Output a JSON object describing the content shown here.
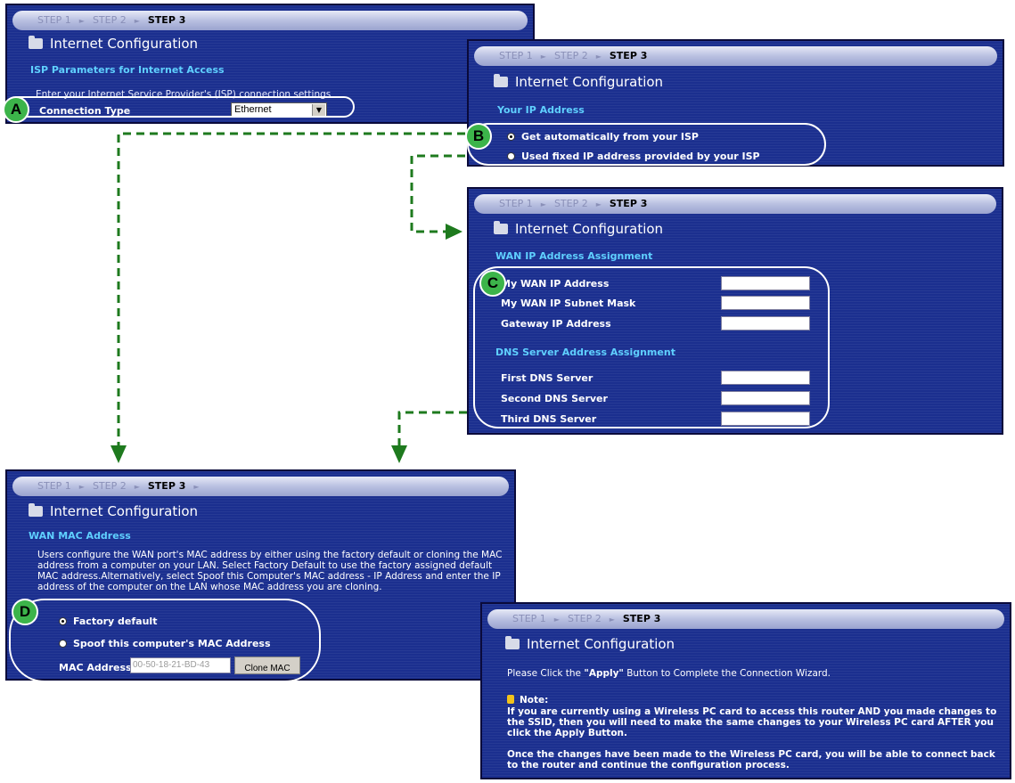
{
  "steps": {
    "step1": "STEP 1",
    "step2": "STEP 2",
    "step3": "STEP 3"
  },
  "panel_title": "Internet Configuration",
  "panel_a": {
    "badge": "A",
    "section": "ISP Parameters for Internet Access",
    "intro": "Enter your Internet Service Provider's (ISP) connection settings",
    "connection_type_label": "Connection Type",
    "connection_type_value": "Ethernet"
  },
  "panel_b": {
    "badge": "B",
    "section": "Your IP Address",
    "option_auto": "Get automatically from your ISP",
    "option_fixed": "Used fixed IP address provided by your ISP",
    "selected": "auto"
  },
  "panel_c": {
    "badge": "C",
    "section_wan": "WAN IP Address Assignment",
    "wan_ip_label": "My WAN IP Address",
    "subnet_label": "My WAN IP Subnet Mask",
    "gateway_label": "Gateway IP Address",
    "section_dns": "DNS Server Address Assignment",
    "dns1_label": "First DNS Server",
    "dns2_label": "Second DNS Server",
    "dns3_label": "Third DNS Server"
  },
  "panel_d": {
    "badge": "D",
    "section": "WAN MAC Address",
    "description": "Users configure the WAN port's MAC address by either using the factory default or cloning the MAC address from a computer on your LAN. Select Factory Default to use the factory assigned default MAC address.Alternatively, select Spoof this Computer's MAC address - IP Address and enter the IP address of the computer on the LAN whose MAC address you are cloning.",
    "option_factory": "Factory default",
    "option_spoof": "Spoof this computer's MAC Address",
    "mac_label": "MAC Address",
    "mac_value": "00-50-18-21-BD-43",
    "clone_button": "Clone MAC",
    "selected": "factory"
  },
  "panel_e": {
    "apply_pre": "Please Click the ",
    "apply_bold": "\"Apply\"",
    "apply_post": " Button to Complete the Connection Wizard.",
    "note_label": "Note:",
    "note_text": "If you are currently using a Wireless PC card to access this router AND you made changes to the SSID, then you will need to make the same changes to your Wireless PC card AFTER you click the Apply Button.",
    "followup": "Once the changes have been made to the Wireless PC card, you will be able to connect back to the router and continue the configuration process."
  },
  "colors": {
    "panel_bg": "#1b2f8f",
    "section_text": "#5fd0ff",
    "arrow": "#1e7a1e",
    "badge": "#3cb44a"
  }
}
